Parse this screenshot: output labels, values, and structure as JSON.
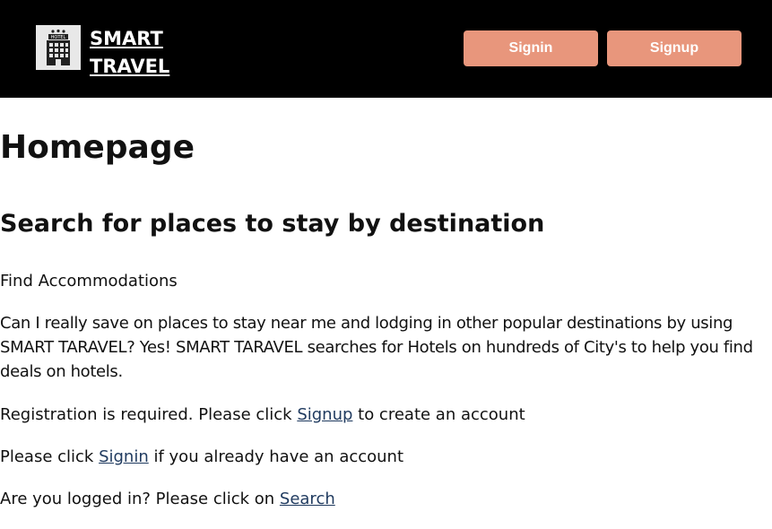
{
  "header": {
    "brand_line1": "SMART",
    "brand_line2": "TRAVEL",
    "logo_icon": "hotel-building-icon",
    "logo_sign_text": "HOTEL",
    "signin_label": "Signin",
    "signup_label": "Signup",
    "colors": {
      "bar": "#000000",
      "button": "#e8967c",
      "button_text": "#ffffff"
    }
  },
  "main": {
    "title": "Homepage",
    "subtitle": "Search for places to stay by destination",
    "find_text": "Find Accommodations",
    "description": "Can I really save on places to stay near me and lodging in other popular destinations by using SMART TARAVEL? Yes! SMART TARAVEL searches for Hotels on hundreds of City's to help you find deals on hotels.",
    "registration": {
      "before": "Registration is required. Please click ",
      "link": "Signup",
      "after": " to create an account"
    },
    "signin_line": {
      "before": "Please click ",
      "link": "Signin",
      "after": " if you already have an account"
    },
    "search_line": {
      "before": "Are you logged in? Please click on ",
      "link": "Search"
    },
    "link_color": "#1f3a5f"
  }
}
